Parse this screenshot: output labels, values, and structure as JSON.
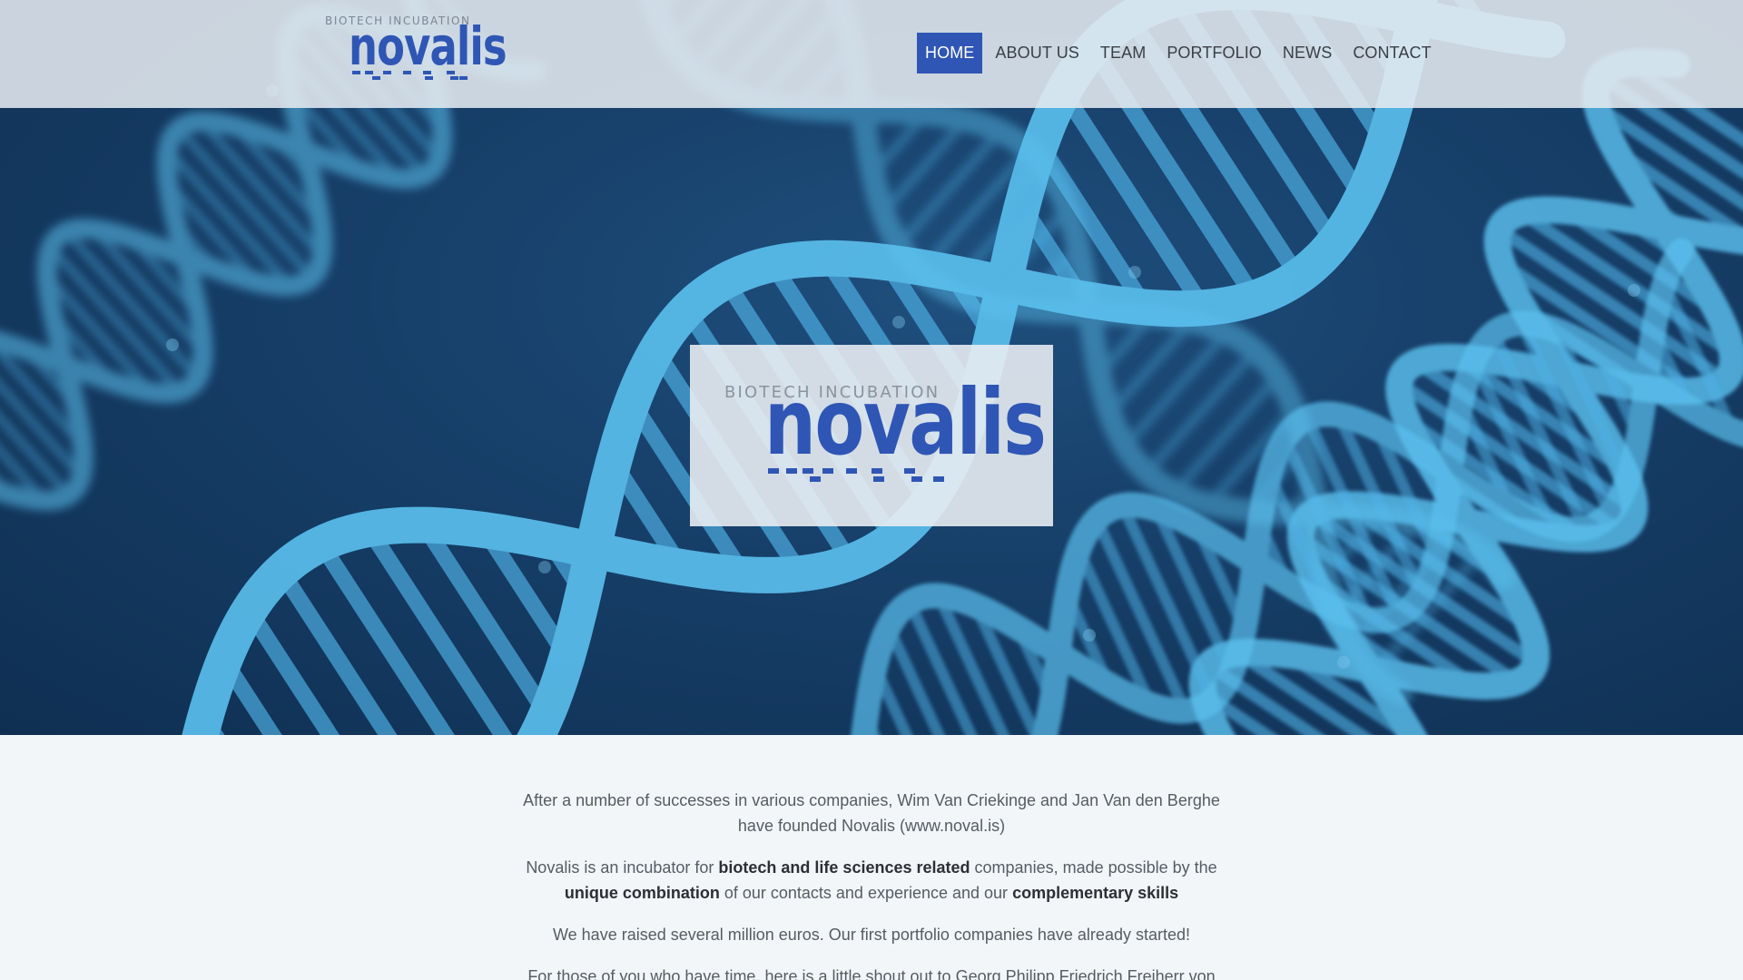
{
  "brand": {
    "tagline": "BIOTECH INCUBATION",
    "name": "novalis",
    "color": "#2f56b5"
  },
  "nav": {
    "items": [
      {
        "label": "HOME",
        "active": true
      },
      {
        "label": "ABOUT US",
        "active": false
      },
      {
        "label": "TEAM",
        "active": false
      },
      {
        "label": "PORTFOLIO",
        "active": false
      },
      {
        "label": "NEWS",
        "active": false
      },
      {
        "label": "CONTACT",
        "active": false
      }
    ]
  },
  "hero": {
    "image": "dna-helix-background",
    "card_tagline": "BIOTECH INCUBATION",
    "card_name": "novalis"
  },
  "content": {
    "p1": "After a number of successes in various companies, Wim Van Criekinge and Jan Van den Berghe have founded Novalis (www.noval.is)",
    "p2_parts": [
      {
        "text": "Novalis is an incubator for ",
        "bold": false
      },
      {
        "text": "biotech and life sciences related",
        "bold": true
      },
      {
        "text": " companies, made possible by the ",
        "bold": false
      },
      {
        "text": "unique combination",
        "bold": true
      },
      {
        "text": " of our contacts and experience and our ",
        "bold": false
      },
      {
        "text": "complementary skills",
        "bold": true
      }
    ],
    "p3": "We have raised several million euros. Our first portfolio companies have already started!",
    "p4": "For those of you who have time, here is a little shout out to Georg Philipp Friedrich Freiherr von"
  }
}
